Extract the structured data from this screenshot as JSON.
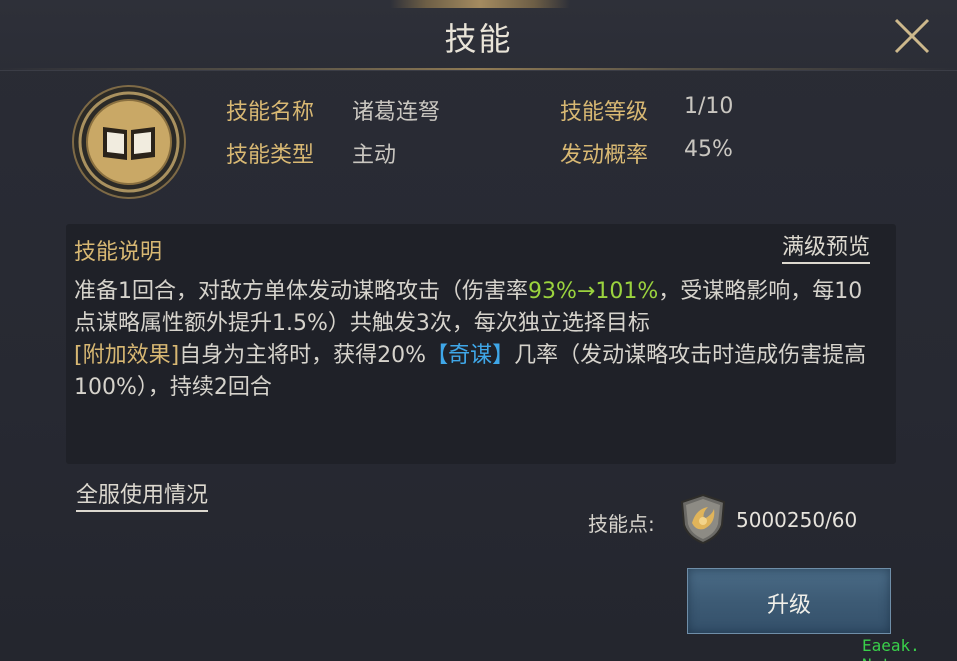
{
  "window": {
    "title": "技能"
  },
  "skill": {
    "name_label": "技能名称",
    "name_value": "诸葛连弩",
    "level_label": "技能等级",
    "level_value": "1/10",
    "type_label": "技能类型",
    "type_value": "主动",
    "chance_label": "发动概率",
    "chance_value": "45%"
  },
  "description": {
    "title": "技能说明",
    "preview_link": "满级预览",
    "line1_a": "准备1回合，对敌方单体发动谋略攻击（伤害率",
    "line1_rate": "93%→101%",
    "line1_b": "，受谋略影响，每10点谋略属性额外提升1.5%）共触发3次，每次独立选择目标",
    "extra_tag": "[附加效果]",
    "line2_a": "自身为主将时，获得20%",
    "line2_key": "【奇谋】",
    "line2_b": "几率（发动谋略攻击时造成伤害提高100%），持续2回合"
  },
  "usage_link": "全服使用情况",
  "points": {
    "label": "技能点:",
    "value": "5000250/60"
  },
  "upgrade_button": "升级",
  "watermark": "Eaeak. Net",
  "icons": {
    "close": "close-icon",
    "skill": "book-icon",
    "points": "shield-emblem-icon"
  },
  "colors": {
    "gold": "#d8b873",
    "green": "#9bd33e",
    "blue": "#3fa7e8",
    "button": "#3d5b75"
  }
}
